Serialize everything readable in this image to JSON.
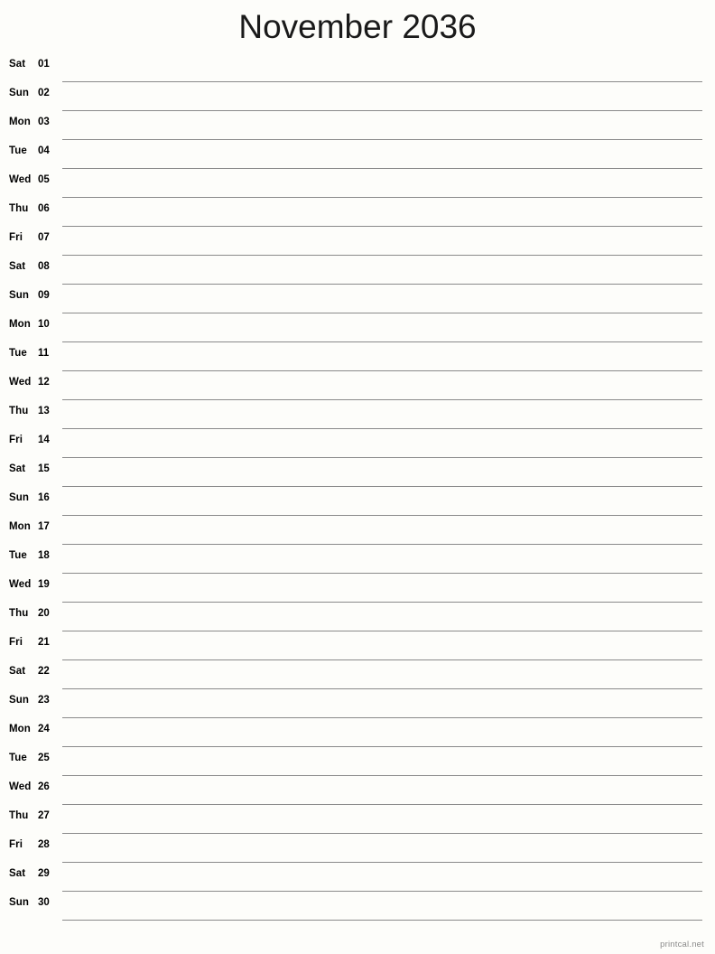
{
  "document": {
    "title": "November 2036",
    "month": "November",
    "year": "2036",
    "footer_text": "printcal.net",
    "line_color": "#8a8a8a",
    "background_color": "#fdfdfa",
    "text_color": "#000000",
    "footer_color": "#8a8a8a"
  },
  "days": [
    {
      "weekday": "Sat",
      "number": "01"
    },
    {
      "weekday": "Sun",
      "number": "02"
    },
    {
      "weekday": "Mon",
      "number": "03"
    },
    {
      "weekday": "Tue",
      "number": "04"
    },
    {
      "weekday": "Wed",
      "number": "05"
    },
    {
      "weekday": "Thu",
      "number": "06"
    },
    {
      "weekday": "Fri",
      "number": "07"
    },
    {
      "weekday": "Sat",
      "number": "08"
    },
    {
      "weekday": "Sun",
      "number": "09"
    },
    {
      "weekday": "Mon",
      "number": "10"
    },
    {
      "weekday": "Tue",
      "number": "11"
    },
    {
      "weekday": "Wed",
      "number": "12"
    },
    {
      "weekday": "Thu",
      "number": "13"
    },
    {
      "weekday": "Fri",
      "number": "14"
    },
    {
      "weekday": "Sat",
      "number": "15"
    },
    {
      "weekday": "Sun",
      "number": "16"
    },
    {
      "weekday": "Mon",
      "number": "17"
    },
    {
      "weekday": "Tue",
      "number": "18"
    },
    {
      "weekday": "Wed",
      "number": "19"
    },
    {
      "weekday": "Thu",
      "number": "20"
    },
    {
      "weekday": "Fri",
      "number": "21"
    },
    {
      "weekday": "Sat",
      "number": "22"
    },
    {
      "weekday": "Sun",
      "number": "23"
    },
    {
      "weekday": "Mon",
      "number": "24"
    },
    {
      "weekday": "Tue",
      "number": "25"
    },
    {
      "weekday": "Wed",
      "number": "26"
    },
    {
      "weekday": "Thu",
      "number": "27"
    },
    {
      "weekday": "Fri",
      "number": "28"
    },
    {
      "weekday": "Sat",
      "number": "29"
    },
    {
      "weekday": "Sun",
      "number": "30"
    }
  ]
}
